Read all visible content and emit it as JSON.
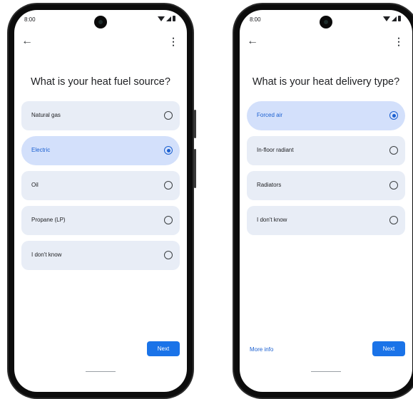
{
  "phones": [
    {
      "status_time": "8:00",
      "title": "What is your heat fuel source?",
      "options": [
        {
          "label": "Natural gas"
        },
        {
          "label": "Electric",
          "selected": true
        },
        {
          "label": "Oil"
        },
        {
          "label": "Propane (LP)"
        },
        {
          "label": "I don't know"
        }
      ],
      "next_label": "Next"
    },
    {
      "status_time": "8:00",
      "title": "What is your heat delivery type?",
      "options": [
        {
          "label": "Forced air",
          "selected": true
        },
        {
          "label": "In-floor radiant"
        },
        {
          "label": "Radiators"
        },
        {
          "label": "I don't know"
        }
      ],
      "more_info_label": "More info",
      "next_label": "Next"
    }
  ],
  "colors": {
    "accent": "#1a73e8",
    "selected_bg": "#d3e0fb",
    "option_bg": "#e8edf6"
  },
  "icons": [
    "back-arrow-icon",
    "more-vert-icon",
    "radio-icon",
    "wifi-icon",
    "signal-icon",
    "battery-icon",
    "camera-icon"
  ]
}
